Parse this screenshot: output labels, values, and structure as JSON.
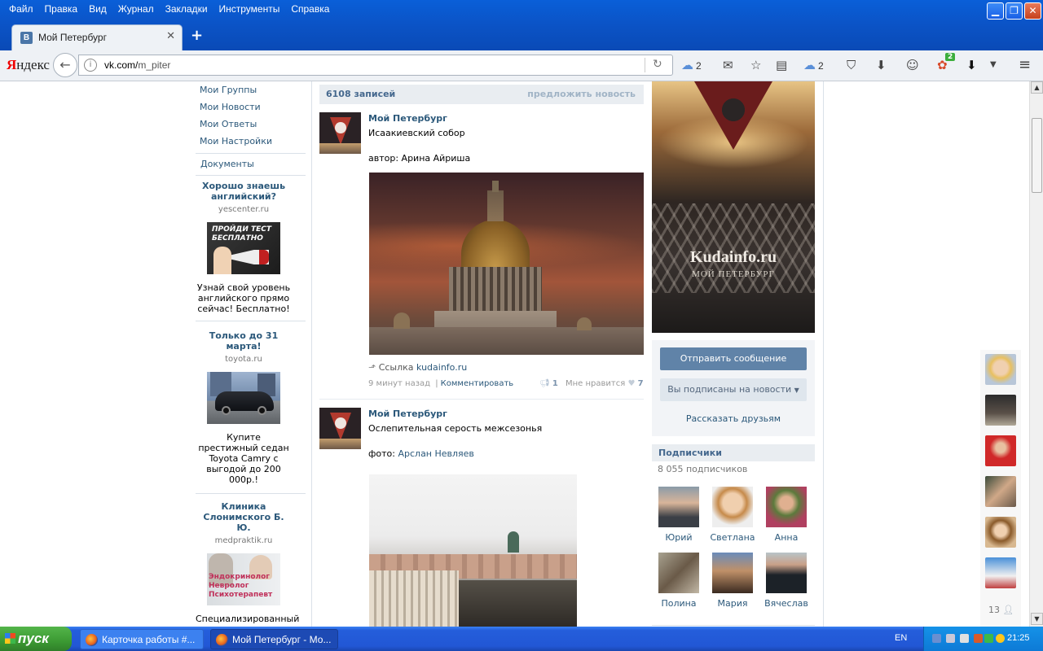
{
  "browser": {
    "menu": [
      "Файл",
      "Правка",
      "Вид",
      "Журнал",
      "Закладки",
      "Инструменты",
      "Справка"
    ],
    "tab_title": "Мой Петербург",
    "tab_favicon": "В",
    "yandex": {
      "first": "Я",
      "rest": "ндекс"
    },
    "url_domain": "vk.com/",
    "url_path": "m_piter",
    "counts": {
      "cloud1": "2",
      "cloud2": "2",
      "badge": "2"
    }
  },
  "left_nav": {
    "items": [
      "Мои Группы",
      "Мои Новости",
      "Мои Ответы",
      "Мои Настройки"
    ],
    "docs": "Документы"
  },
  "ads": [
    {
      "title": "Хорошо знаешь английский?",
      "domain": "yescenter.ru",
      "img_text": "ПРОЙДИ ТЕСТ БЕСПЛАТНО",
      "desc": "Узнай свой уровень английского прямо сейчас! Бесплатно!"
    },
    {
      "title": "Только до 31 марта!",
      "domain": "toyota.ru",
      "desc": "Купите престижный седан Toyota Camry с выгодой до 200 000р.!"
    },
    {
      "title": "Клиника Слонимского Б. Ю.",
      "domain": "medpraktik.ru",
      "img_lines": [
        "Эндокринолог",
        "Невролог",
        "Психотерапевт"
      ],
      "desc": "Специализированный консультативно-"
    }
  ],
  "wall": {
    "count": "6108 записей",
    "suggest": "предложить новость"
  },
  "posts": [
    {
      "author": "Мой Петербург",
      "text": "Исаакиевский собор",
      "credit_prefix": "автор: Арина Айриша",
      "link_prefix": "Ссылка",
      "link": "kudainfo.ru",
      "time": "9 минут назад",
      "sep": "|",
      "comment": "Комментировать",
      "shares": "1",
      "like_label": "Мне нравится",
      "likes": "7"
    },
    {
      "author": "Мой Петербург",
      "text": "Ослепительная серость межсезонья",
      "credit_prefix": "фото:",
      "credit_name": "Арслан Невляев"
    }
  ],
  "group": {
    "cover_brand": "Kudainfo.ru",
    "cover_sub": "МОЙ ПЕТЕРБУРГ",
    "send_message": "Отправить сообщение",
    "subscribed": "Вы подписаны на новости",
    "tell_friends": "Рассказать друзьям",
    "subs_header": "Подписчики",
    "subs_count": "8 055 подписчиков",
    "subscribers": [
      "Юрий",
      "Светлана",
      "Анна",
      "Полина",
      "Мария",
      "Вячеслав"
    ]
  },
  "friends_bar": {
    "count": "13"
  },
  "taskbar": {
    "start": "пуск",
    "task1": "Карточка работы #...",
    "task2": "Мой Петербург - Мо...",
    "lang": "EN",
    "clock": "21:25"
  }
}
